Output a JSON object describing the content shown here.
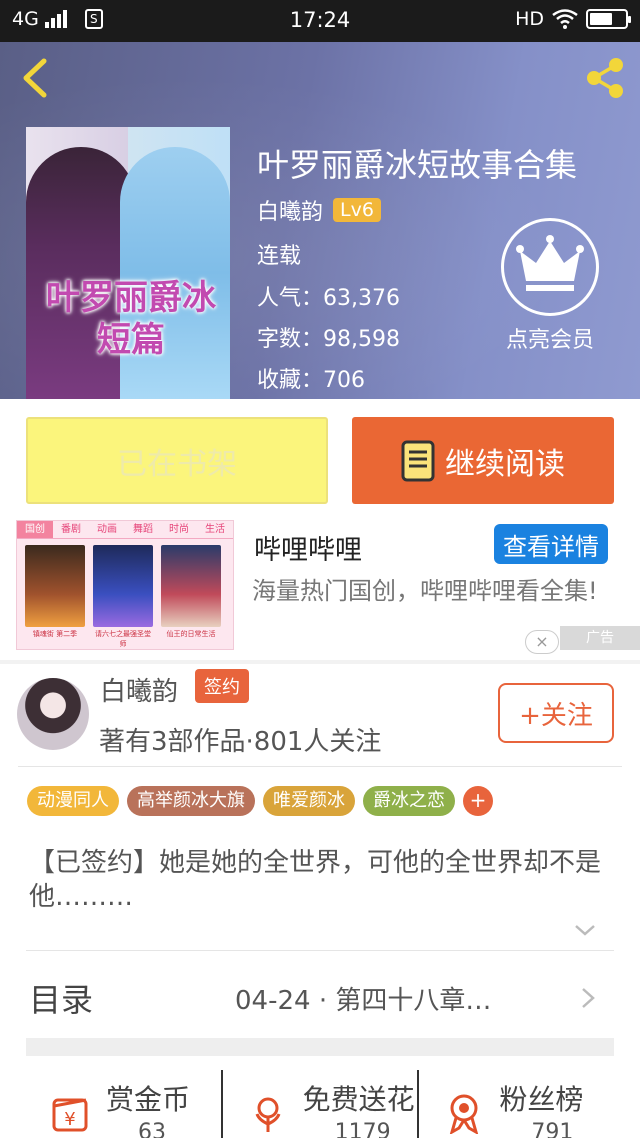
{
  "status_bar": {
    "network": "4G",
    "sim_label": "S",
    "time": "17:24",
    "hd": "HD"
  },
  "book": {
    "title": "叶罗丽爵冰短故事合集",
    "author": "白曦韵",
    "level": "Lv6",
    "status": "连载",
    "popularity": "人气：63,376",
    "words": "字数：98,598",
    "favorites": "收藏：706",
    "cover_title": "叶罗丽爵冰短篇"
  },
  "vip": {
    "label": "点亮会员"
  },
  "actions": {
    "shelf_label": "已在书架",
    "read_label": "继续阅读"
  },
  "ad": {
    "name": "哔哩哔哩",
    "button": "查看详情",
    "description": "海量热门国创，哔哩哔哩看全集!",
    "tag": "广告",
    "close": "×",
    "thumb_tabs": [
      "国创",
      "番剧",
      "动画",
      "舞蹈",
      "时尚",
      "生活"
    ],
    "poster_captions": [
      "镇魂街 第二季",
      "请六七之最强圣堂师",
      "仙王的日常生活"
    ]
  },
  "author_card": {
    "name": "白曦韵",
    "badge": "签约",
    "stats": "著有3部作品·801人关注",
    "follow": "+关注"
  },
  "tags": [
    {
      "label": "动漫同人",
      "color": "#f2b73a"
    },
    {
      "label": "高举颜冰大旗",
      "color": "#b9725a"
    },
    {
      "label": "唯爱颜冰",
      "color": "#d9a43a"
    },
    {
      "label": "爵冰之恋",
      "color": "#8fb04a"
    }
  ],
  "tag_add": "+",
  "description": "【已签约】她是她的全世界，可他的全世界却不是他………",
  "toc": {
    "label": "目录",
    "latest": "04-24 · 第四十八章…"
  },
  "stats": [
    {
      "label": "赏金币",
      "value": "63",
      "icon": "gold-coin-icon"
    },
    {
      "label": "免费送花",
      "value": "1179",
      "icon": "flower-icon"
    },
    {
      "label": "粉丝榜",
      "value": "791",
      "icon": "medal-icon"
    }
  ],
  "colors": {
    "accent": "#e8643c",
    "shelf": "#fbf57c",
    "ad_button": "#1a82e0"
  }
}
